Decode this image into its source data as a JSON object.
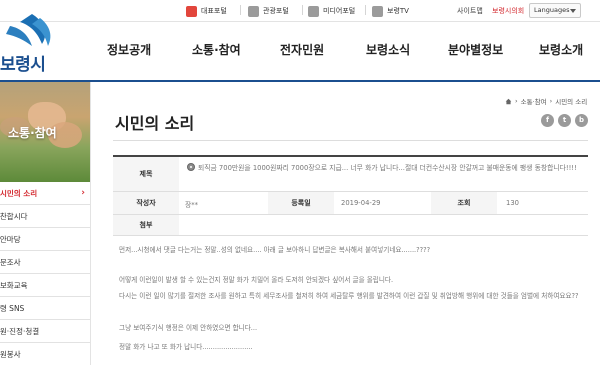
{
  "topbar": {
    "portals": [
      {
        "label": "대표포털",
        "icon": "building-icon",
        "color": "#e2463c"
      },
      {
        "label": "관광포털",
        "icon": "tour-icon",
        "color": "#888888"
      },
      {
        "label": "미디어포털",
        "icon": "media-icon",
        "color": "#888888"
      },
      {
        "label": "보령TV",
        "icon": "tv-icon",
        "color": "#888888"
      }
    ],
    "sitemap": "사이트맵",
    "council": "보령시의회",
    "language": "Languages"
  },
  "logo": {
    "text": "보령시"
  },
  "gnb": [
    "정보공개",
    "소통·참여",
    "전자민원",
    "보령소식",
    "분야별정보",
    "보령소개"
  ],
  "sidebar": {
    "title": "소통·참여",
    "items": [
      {
        "label": "시민의 소리",
        "active": true
      },
      {
        "label": "칭찬합시다",
        "active": false
      },
      {
        "label": "제안마당",
        "active": false
      },
      {
        "label": "설문조사",
        "active": false
      },
      {
        "label": "정보화교육",
        "active": false
      },
      {
        "label": "보령 SNS",
        "active": false
      },
      {
        "label": "민원·진정·청결",
        "active": false
      },
      {
        "label": "자원봉사",
        "active": false
      }
    ]
  },
  "breadcrumb": [
    "소통·참여",
    "시민의 소리"
  ],
  "page_title": "시민의 소리",
  "share": [
    "f",
    "t",
    "b"
  ],
  "post": {
    "subject_label": "제목",
    "subject": "퇴직금 700만원을 1000원짜리 7000장으로 지급... 너무 화가 납니다...절대 더컨수산시장 안갈꺼고 불매운동에 팽생 동창합니다!!!!",
    "author_label": "작성자",
    "author": "장**",
    "date_label": "등록일",
    "date": "2019-04-29",
    "views_label": "조회",
    "views": "130",
    "attach_label": "첨부",
    "body": [
      "먼저...시청에서 댓글 다는거는 정말..성의 없네요.... 아래 글 보아하니 답변글은 복사해서 붙여넣기네요.......????",
      "어떻게 이런일이 발생 할 수 있는건지 정말 화가 치밀어 올라 도저히 안되겠다 싶어서 글을 올립니다.",
      "다시는 이런 일이 많기를 절저한 조사를 원하고 특히 세무조사를 철저히 하여 세금탈루 행위를 발견하여 이런 갑질 및 취업방해 행위에 대한 것들을 엄벌에 처하여요요??",
      "그냥 보여주기식 행정은 이제 안하였으면 합니다...",
      "정말 화가 나고 또 화가 납니다........................"
    ]
  }
}
